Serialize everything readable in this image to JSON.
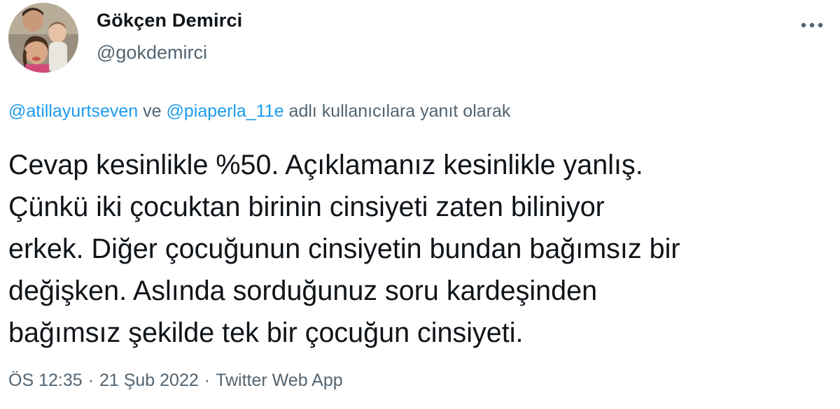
{
  "author": {
    "display_name": "Gökçen Demirci",
    "handle": "@gokdemirci",
    "avatar_icon": "profile-photo"
  },
  "more_icon": "more-horizontal-icon",
  "reply": {
    "mention_1": "@atillayurtseven",
    "connector": "ve",
    "mention_2": "@piaperla_11e",
    "suffix": "adlı kullanıcılara yanıt olarak"
  },
  "tweet": {
    "lines": [
      "Cevap kesinlikle %50. Açıklamanız kesinlikle yanlış.",
      "Çünkü iki çocuktan birinin cinsiyeti zaten biliniyor",
      "erkek. Diğer çocuğunun cinsiyetin bundan bağımsız bir",
      "değişken. Aslında sorduğunuz soru kardeşinden",
      "bağımsız şekilde tek bir çocuğun cinsiyeti."
    ]
  },
  "meta": {
    "time": "ÖS 12:35",
    "separator": "·",
    "date": "21 Şub 2022",
    "source": "Twitter Web App"
  },
  "colors": {
    "text": "#0f1419",
    "secondary": "#536471",
    "link": "#1d9bf0"
  }
}
